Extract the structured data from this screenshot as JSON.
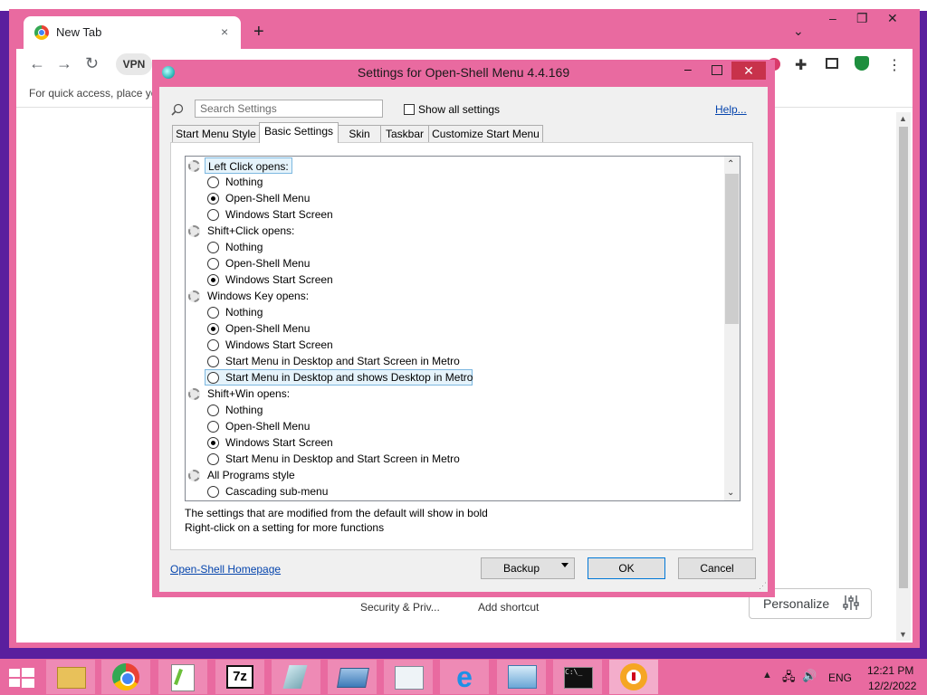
{
  "browser": {
    "tab_title": "New Tab",
    "tab_close": "×",
    "new_tab": "+",
    "tab_search": "⌄",
    "window_controls": {
      "minimize": "–",
      "maximize": "❐",
      "close": "✕"
    },
    "nav": {
      "back": "←",
      "forward": "→",
      "reload": "↻"
    },
    "vpn_label": "VPN",
    "bookmarks_hint": "For quick access, place yo",
    "shortcuts": [
      "Security & Priv...",
      "Add shortcut"
    ],
    "personalize_label": "Personalize"
  },
  "dialog": {
    "title": "Settings for Open-Shell Menu 4.4.169",
    "close": "✕",
    "minimize": "–",
    "search_placeholder": "Search Settings",
    "show_all_label": "Show all settings",
    "help_link": "Help...",
    "tabs": [
      {
        "label": "Start Menu Style",
        "selected": false
      },
      {
        "label": "Basic Settings",
        "selected": true
      },
      {
        "label": "Skin",
        "selected": false
      },
      {
        "label": "Taskbar",
        "selected": false
      },
      {
        "label": "Customize Start Menu",
        "selected": false
      }
    ],
    "groups": [
      {
        "label": "Left Click opens:",
        "options": [
          {
            "label": "Nothing",
            "selected": false
          },
          {
            "label": "Open-Shell Menu",
            "selected": true
          },
          {
            "label": "Windows Start Screen",
            "selected": false
          }
        ]
      },
      {
        "label": "Shift+Click opens:",
        "options": [
          {
            "label": "Nothing",
            "selected": false
          },
          {
            "label": "Open-Shell Menu",
            "selected": false
          },
          {
            "label": "Windows Start Screen",
            "selected": true
          }
        ]
      },
      {
        "label": "Windows Key opens:",
        "options": [
          {
            "label": "Nothing",
            "selected": false
          },
          {
            "label": "Open-Shell Menu",
            "selected": true
          },
          {
            "label": "Windows Start Screen",
            "selected": false
          },
          {
            "label": "Start Menu in Desktop and Start Screen in Metro",
            "selected": false
          },
          {
            "label": "Start Menu in Desktop and shows Desktop in Metro",
            "selected": false
          }
        ]
      },
      {
        "label": "Shift+Win opens:",
        "options": [
          {
            "label": "Nothing",
            "selected": false
          },
          {
            "label": "Open-Shell Menu",
            "selected": false
          },
          {
            "label": "Windows Start Screen",
            "selected": true
          },
          {
            "label": "Start Menu in Desktop and Start Screen in Metro",
            "selected": false
          }
        ]
      },
      {
        "label": "All Programs style",
        "options": [
          {
            "label": "Cascading sub-menu",
            "selected": false
          }
        ]
      }
    ],
    "info_line1": "The settings that are modified from the default will show in bold",
    "info_line2": "Right-click on a setting for more functions",
    "homepage_link": "Open-Shell Homepage",
    "buttons": {
      "backup": "Backup",
      "ok": "OK",
      "cancel": "Cancel"
    }
  },
  "taskbar": {
    "apps": [
      "file-explorer",
      "chrome",
      "notepad-plus",
      "7-zip",
      "eraser",
      "remote-desktop",
      "task-manager",
      "internet-explorer",
      "control-panel",
      "command-prompt",
      "open-shell"
    ],
    "tray_language": "ENG",
    "clock_time": "12:21 PM",
    "clock_date": "12/2/2022"
  },
  "colors": {
    "accent": "#e96aa0",
    "close_red": "#c8324b",
    "link": "#0645ad",
    "desktop": "#5a1f9e"
  }
}
